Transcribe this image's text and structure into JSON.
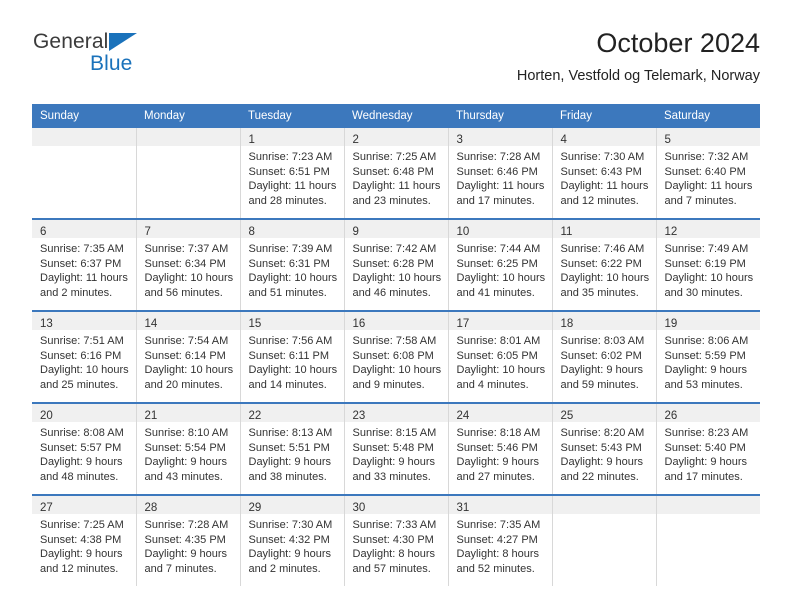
{
  "brand": {
    "name_top": "General",
    "name_bottom": "Blue",
    "triangle_color": "#1a72bb"
  },
  "header": {
    "title": "October 2024",
    "subtitle": "Horten, Vestfold og Telemark, Norway"
  },
  "colors": {
    "header_blue": "#3c78bd",
    "daynum_band": "#f0f0f0",
    "text": "#333333"
  },
  "calendar": {
    "weekday_headers": [
      "Sunday",
      "Monday",
      "Tuesday",
      "Wednesday",
      "Thursday",
      "Friday",
      "Saturday"
    ],
    "weeks": [
      [
        {
          "day": "",
          "lines": []
        },
        {
          "day": "",
          "lines": []
        },
        {
          "day": "1",
          "lines": [
            "Sunrise: 7:23 AM",
            "Sunset: 6:51 PM",
            "Daylight: 11 hours",
            "and 28 minutes."
          ]
        },
        {
          "day": "2",
          "lines": [
            "Sunrise: 7:25 AM",
            "Sunset: 6:48 PM",
            "Daylight: 11 hours",
            "and 23 minutes."
          ]
        },
        {
          "day": "3",
          "lines": [
            "Sunrise: 7:28 AM",
            "Sunset: 6:46 PM",
            "Daylight: 11 hours",
            "and 17 minutes."
          ]
        },
        {
          "day": "4",
          "lines": [
            "Sunrise: 7:30 AM",
            "Sunset: 6:43 PM",
            "Daylight: 11 hours",
            "and 12 minutes."
          ]
        },
        {
          "day": "5",
          "lines": [
            "Sunrise: 7:32 AM",
            "Sunset: 6:40 PM",
            "Daylight: 11 hours",
            "and 7 minutes."
          ]
        }
      ],
      [
        {
          "day": "6",
          "lines": [
            "Sunrise: 7:35 AM",
            "Sunset: 6:37 PM",
            "Daylight: 11 hours",
            "and 2 minutes."
          ]
        },
        {
          "day": "7",
          "lines": [
            "Sunrise: 7:37 AM",
            "Sunset: 6:34 PM",
            "Daylight: 10 hours",
            "and 56 minutes."
          ]
        },
        {
          "day": "8",
          "lines": [
            "Sunrise: 7:39 AM",
            "Sunset: 6:31 PM",
            "Daylight: 10 hours",
            "and 51 minutes."
          ]
        },
        {
          "day": "9",
          "lines": [
            "Sunrise: 7:42 AM",
            "Sunset: 6:28 PM",
            "Daylight: 10 hours",
            "and 46 minutes."
          ]
        },
        {
          "day": "10",
          "lines": [
            "Sunrise: 7:44 AM",
            "Sunset: 6:25 PM",
            "Daylight: 10 hours",
            "and 41 minutes."
          ]
        },
        {
          "day": "11",
          "lines": [
            "Sunrise: 7:46 AM",
            "Sunset: 6:22 PM",
            "Daylight: 10 hours",
            "and 35 minutes."
          ]
        },
        {
          "day": "12",
          "lines": [
            "Sunrise: 7:49 AM",
            "Sunset: 6:19 PM",
            "Daylight: 10 hours",
            "and 30 minutes."
          ]
        }
      ],
      [
        {
          "day": "13",
          "lines": [
            "Sunrise: 7:51 AM",
            "Sunset: 6:16 PM",
            "Daylight: 10 hours",
            "and 25 minutes."
          ]
        },
        {
          "day": "14",
          "lines": [
            "Sunrise: 7:54 AM",
            "Sunset: 6:14 PM",
            "Daylight: 10 hours",
            "and 20 minutes."
          ]
        },
        {
          "day": "15",
          "lines": [
            "Sunrise: 7:56 AM",
            "Sunset: 6:11 PM",
            "Daylight: 10 hours",
            "and 14 minutes."
          ]
        },
        {
          "day": "16",
          "lines": [
            "Sunrise: 7:58 AM",
            "Sunset: 6:08 PM",
            "Daylight: 10 hours",
            "and 9 minutes."
          ]
        },
        {
          "day": "17",
          "lines": [
            "Sunrise: 8:01 AM",
            "Sunset: 6:05 PM",
            "Daylight: 10 hours",
            "and 4 minutes."
          ]
        },
        {
          "day": "18",
          "lines": [
            "Sunrise: 8:03 AM",
            "Sunset: 6:02 PM",
            "Daylight: 9 hours",
            "and 59 minutes."
          ]
        },
        {
          "day": "19",
          "lines": [
            "Sunrise: 8:06 AM",
            "Sunset: 5:59 PM",
            "Daylight: 9 hours",
            "and 53 minutes."
          ]
        }
      ],
      [
        {
          "day": "20",
          "lines": [
            "Sunrise: 8:08 AM",
            "Sunset: 5:57 PM",
            "Daylight: 9 hours",
            "and 48 minutes."
          ]
        },
        {
          "day": "21",
          "lines": [
            "Sunrise: 8:10 AM",
            "Sunset: 5:54 PM",
            "Daylight: 9 hours",
            "and 43 minutes."
          ]
        },
        {
          "day": "22",
          "lines": [
            "Sunrise: 8:13 AM",
            "Sunset: 5:51 PM",
            "Daylight: 9 hours",
            "and 38 minutes."
          ]
        },
        {
          "day": "23",
          "lines": [
            "Sunrise: 8:15 AM",
            "Sunset: 5:48 PM",
            "Daylight: 9 hours",
            "and 33 minutes."
          ]
        },
        {
          "day": "24",
          "lines": [
            "Sunrise: 8:18 AM",
            "Sunset: 5:46 PM",
            "Daylight: 9 hours",
            "and 27 minutes."
          ]
        },
        {
          "day": "25",
          "lines": [
            "Sunrise: 8:20 AM",
            "Sunset: 5:43 PM",
            "Daylight: 9 hours",
            "and 22 minutes."
          ]
        },
        {
          "day": "26",
          "lines": [
            "Sunrise: 8:23 AM",
            "Sunset: 5:40 PM",
            "Daylight: 9 hours",
            "and 17 minutes."
          ]
        }
      ],
      [
        {
          "day": "27",
          "lines": [
            "Sunrise: 7:25 AM",
            "Sunset: 4:38 PM",
            "Daylight: 9 hours",
            "and 12 minutes."
          ]
        },
        {
          "day": "28",
          "lines": [
            "Sunrise: 7:28 AM",
            "Sunset: 4:35 PM",
            "Daylight: 9 hours",
            "and 7 minutes."
          ]
        },
        {
          "day": "29",
          "lines": [
            "Sunrise: 7:30 AM",
            "Sunset: 4:32 PM",
            "Daylight: 9 hours",
            "and 2 minutes."
          ]
        },
        {
          "day": "30",
          "lines": [
            "Sunrise: 7:33 AM",
            "Sunset: 4:30 PM",
            "Daylight: 8 hours",
            "and 57 minutes."
          ]
        },
        {
          "day": "31",
          "lines": [
            "Sunrise: 7:35 AM",
            "Sunset: 4:27 PM",
            "Daylight: 8 hours",
            "and 52 minutes."
          ]
        },
        {
          "day": "",
          "lines": []
        },
        {
          "day": "",
          "lines": []
        }
      ]
    ]
  }
}
